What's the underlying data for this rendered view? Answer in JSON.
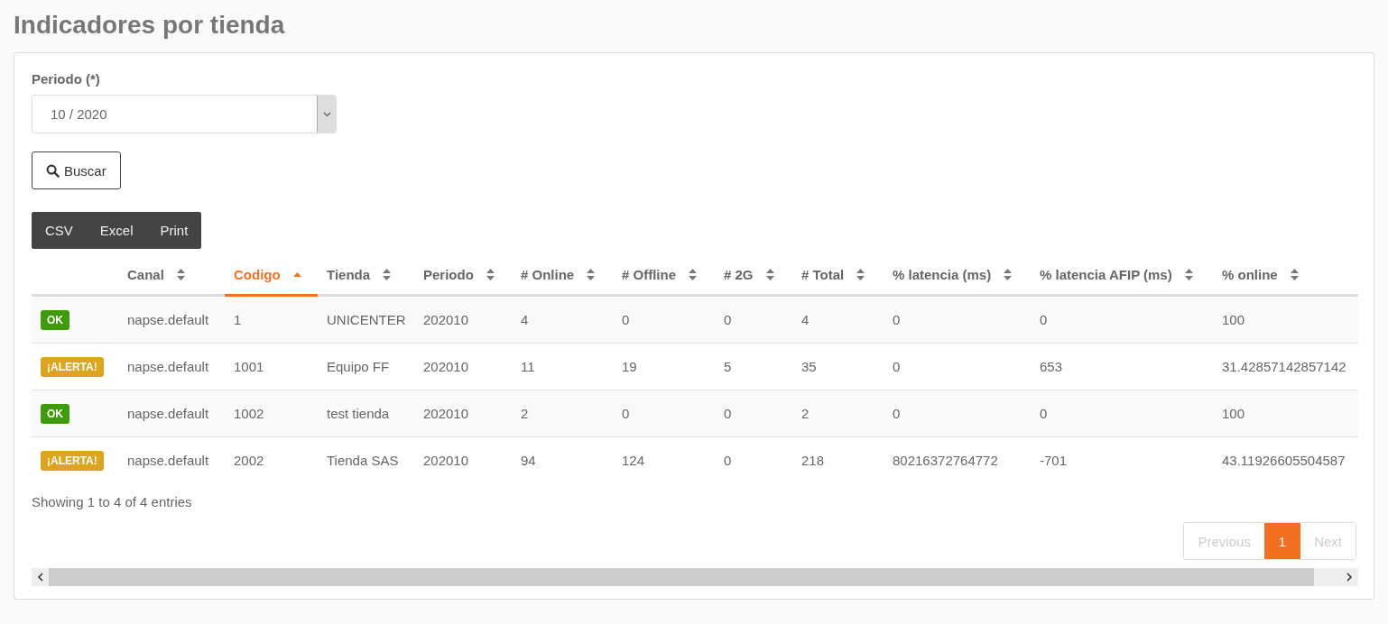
{
  "page_title": "Indicadores por tienda",
  "filter": {
    "label": "Periodo (*)",
    "value": "10 / 2020"
  },
  "search_button": "Buscar",
  "export_buttons": [
    "CSV",
    "Excel",
    "Print"
  ],
  "table": {
    "columns": [
      {
        "sortable": false,
        "sorted_ascending": false
      },
      {
        "label": "Canal",
        "sortable": true,
        "sorted_ascending": false
      },
      {
        "label": "Codigo",
        "sortable": true,
        "sorted_ascending": true
      },
      {
        "label": "Tienda",
        "sortable": true,
        "sorted_ascending": false
      },
      {
        "label": "Periodo",
        "sortable": true,
        "sorted_ascending": false
      },
      {
        "label": "# Online",
        "sortable": true,
        "sorted_ascending": false
      },
      {
        "label": "# Offline",
        "sortable": true,
        "sorted_ascending": false
      },
      {
        "label": "# 2G",
        "sortable": true,
        "sorted_ascending": false
      },
      {
        "label": "# Total",
        "sortable": true,
        "sorted_ascending": false
      },
      {
        "label": "% latencia (ms)",
        "sortable": true,
        "sorted_ascending": false
      },
      {
        "label": "% latencia AFIP (ms)",
        "sortable": true,
        "sorted_ascending": false
      },
      {
        "label": "% online",
        "sortable": true,
        "sorted_ascending": false
      }
    ],
    "rows": [
      {
        "kind": "ok",
        "cells": [
          "OK",
          "napse.default",
          "1",
          "UNICENTER",
          "202010",
          "4",
          "0",
          "0",
          "4",
          "0",
          "0",
          "100"
        ]
      },
      {
        "kind": "alert",
        "cells": [
          "¡ALERTA!",
          "napse.default",
          "1001",
          "Equipo FF",
          "202010",
          "11",
          "19",
          "5",
          "35",
          "0",
          "653",
          "31.42857142857142"
        ]
      },
      {
        "kind": "ok",
        "cells": [
          "OK",
          "napse.default",
          "1002",
          "test tienda",
          "202010",
          "2",
          "0",
          "0",
          "2",
          "0",
          "0",
          "100"
        ]
      },
      {
        "kind": "alert",
        "cells": [
          "¡ALERTA!",
          "napse.default",
          "2002",
          "Tienda SAS",
          "202010",
          "94",
          "124",
          "0",
          "218",
          "80216372764772",
          "-701",
          "43.11926605504587"
        ]
      }
    ]
  },
  "info": "Showing 1 to 4 of 4 entries",
  "pagination": [
    {
      "label": "Previous",
      "disabled": true,
      "selected": false
    },
    {
      "label": "1",
      "disabled": false,
      "selected": true
    },
    {
      "label": "Next",
      "disabled": true,
      "selected": false
    }
  ]
}
